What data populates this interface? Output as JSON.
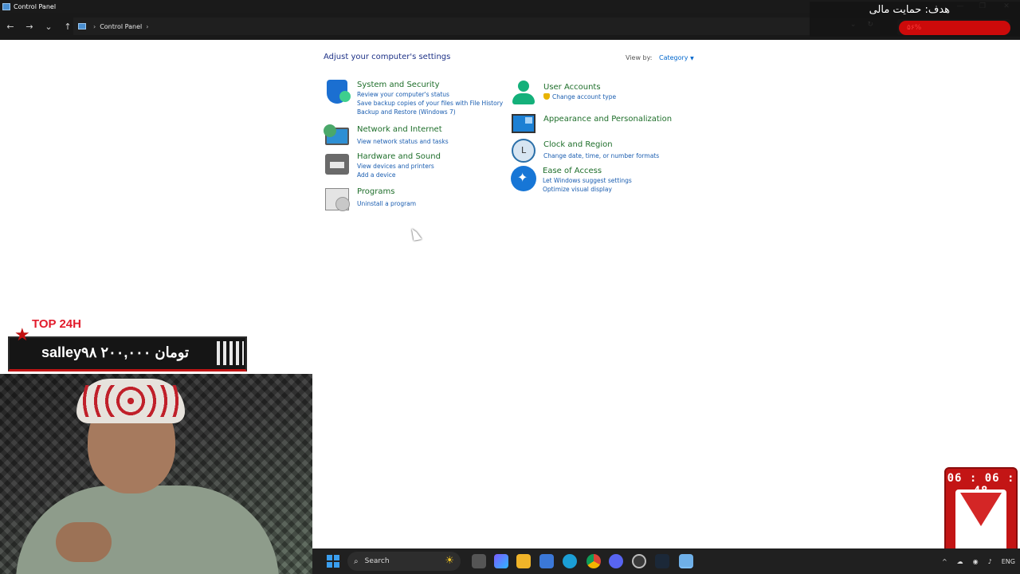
{
  "window": {
    "title": "Control Panel",
    "minimize": "—",
    "maximize": "❐",
    "close": "✕"
  },
  "nav": {
    "back": "←",
    "forward": "→",
    "history": "⌄",
    "up": "↑",
    "breadcrumb": "Control Panel",
    "sep1": "›",
    "sep2": "›",
    "dropdown": "⌄",
    "refresh": "↻"
  },
  "overlay_goal": {
    "title": "هدف: حمایت مالی",
    "percent": "۵۶%"
  },
  "main": {
    "heading": "Adjust your computer's settings",
    "view_by_label": "View by:",
    "view_by_value": "Category",
    "caret": "▼",
    "categories_left": [
      {
        "name": "System and Security",
        "links": [
          "Review your computer's status",
          "Save backup copies of your files with File History",
          "Backup and Restore (Windows 7)"
        ]
      },
      {
        "name": "Network and Internet",
        "links": [
          "View network status and tasks"
        ]
      },
      {
        "name": "Hardware and Sound",
        "links": [
          "View devices and printers",
          "Add a device"
        ]
      },
      {
        "name": "Programs",
        "links": [
          "Uninstall a program"
        ]
      }
    ],
    "categories_right": [
      {
        "name": "User Accounts",
        "links": [
          "Change account type"
        ]
      },
      {
        "name": "Appearance and Personalization",
        "links": []
      },
      {
        "name": "Clock and Region",
        "links": [
          "Change date, time, or number formats"
        ]
      },
      {
        "name": "Ease of Access",
        "links": [
          "Let Windows suggest settings",
          "Optimize visual display"
        ]
      }
    ]
  },
  "donation": {
    "top_label": "TOP 24H",
    "text": "salley۹۸  ۲۰۰,۰۰۰ تومان"
  },
  "timer": {
    "time": "06 : 06 : 48"
  },
  "taskbar": {
    "search_label": "Search",
    "search_icon": "⌕",
    "weather_icon": "☀",
    "tray_chevron": "^",
    "tray_lang": "ENG"
  },
  "colors": {
    "category_green": "#1e6e2a",
    "link_blue": "#1a5db0",
    "heading_blue": "#1e3287",
    "accent_red": "#c31515"
  }
}
